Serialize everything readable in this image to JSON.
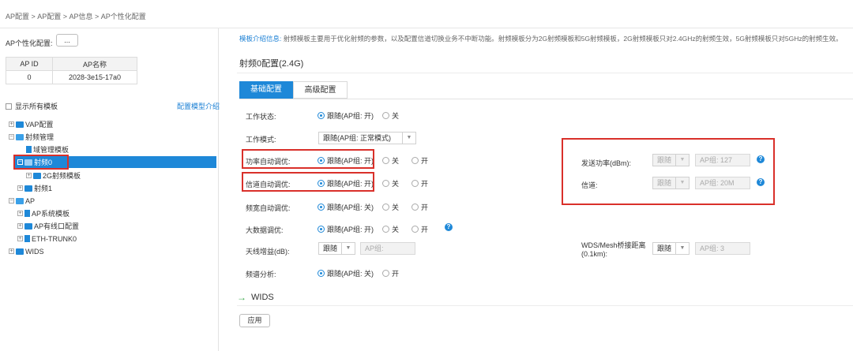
{
  "breadcrumb": "AP配置 > AP配置 > AP信息 > AP个性化配置",
  "left": {
    "profile_label": "AP个性化配置:",
    "dots_label": "...",
    "table": {
      "headers": [
        "AP ID",
        "AP名称"
      ],
      "rows": [
        [
          "0",
          "2028-3e15-17a0"
        ]
      ]
    },
    "show_all_label": "显示所有模板",
    "template_link": "配置模型介绍",
    "tree": {
      "vap": "VAP配置",
      "radio_mgmt": "射频管理",
      "domain_tpl": "域管理模板",
      "radio0": "射频0",
      "radio_2g": "2G射频模板",
      "radio1": "射频1",
      "ap": "AP",
      "ap_system": "AP系统模板",
      "ap_wired": "AP有线口配置",
      "eth_trunk": "ETH-TRUNK0",
      "wids": "WIDS"
    }
  },
  "right": {
    "info_key": "模板介绍信息:",
    "info_text": "射频模板主要用于优化射频的参数，以及配置信道切换业务不中断功能。射频模板分为2G射频模板和5G射频模板，2G射频模板只对2.4GHz的射频生效，5G射频模板只对5GHz的射频生效。",
    "section_title": "射频0配置(2.4G)",
    "tabs": {
      "basic": "基础配置",
      "advanced": "高级配置"
    },
    "fields": {
      "work_state": {
        "label": "工作状态:",
        "opt1": "跟随(AP组: 开)",
        "opt2": "关"
      },
      "work_mode": {
        "label": "工作模式:",
        "value": "跟随(AP组: 正常模式)"
      },
      "power_auto": {
        "label": "功率自动调优:",
        "opt1": "跟随(AP组: 开)",
        "opt2": "关",
        "opt3": "开"
      },
      "channel_auto": {
        "label": "信道自动调优:",
        "opt1": "跟随(AP组: 开)",
        "opt2": "关",
        "opt3": "开"
      },
      "bw_auto": {
        "label": "频宽自动调优:",
        "opt1": "跟随(AP组: 关)",
        "opt2": "关",
        "opt3": "开"
      },
      "bigdata": {
        "label": "大数据调优:",
        "opt1": "跟随(AP组: 开)",
        "opt2": "关",
        "opt3": "开"
      },
      "antenna_gain": {
        "label": "天线增益(dB):",
        "select": "跟随",
        "input": "AP组:"
      },
      "spectrum": {
        "label": "频谱分析:",
        "opt1": "跟随(AP组: 关)",
        "opt2": "开"
      },
      "tx_power": {
        "label": "发送功率(dBm):",
        "select": "跟随",
        "input": "AP组: 127"
      },
      "channel": {
        "label": "信道:",
        "select": "跟随",
        "input": "AP组: 20M"
      },
      "wds_distance": {
        "label_line1": "WDS/Mesh桥接距离",
        "label_line2": "(0.1km):",
        "select": "跟随",
        "input": "AP组: 3"
      }
    },
    "wids_section": "WIDS",
    "apply_label": "应用"
  },
  "colors": {
    "accent": "#1e88d8",
    "highlight_box": "#d9302a"
  }
}
